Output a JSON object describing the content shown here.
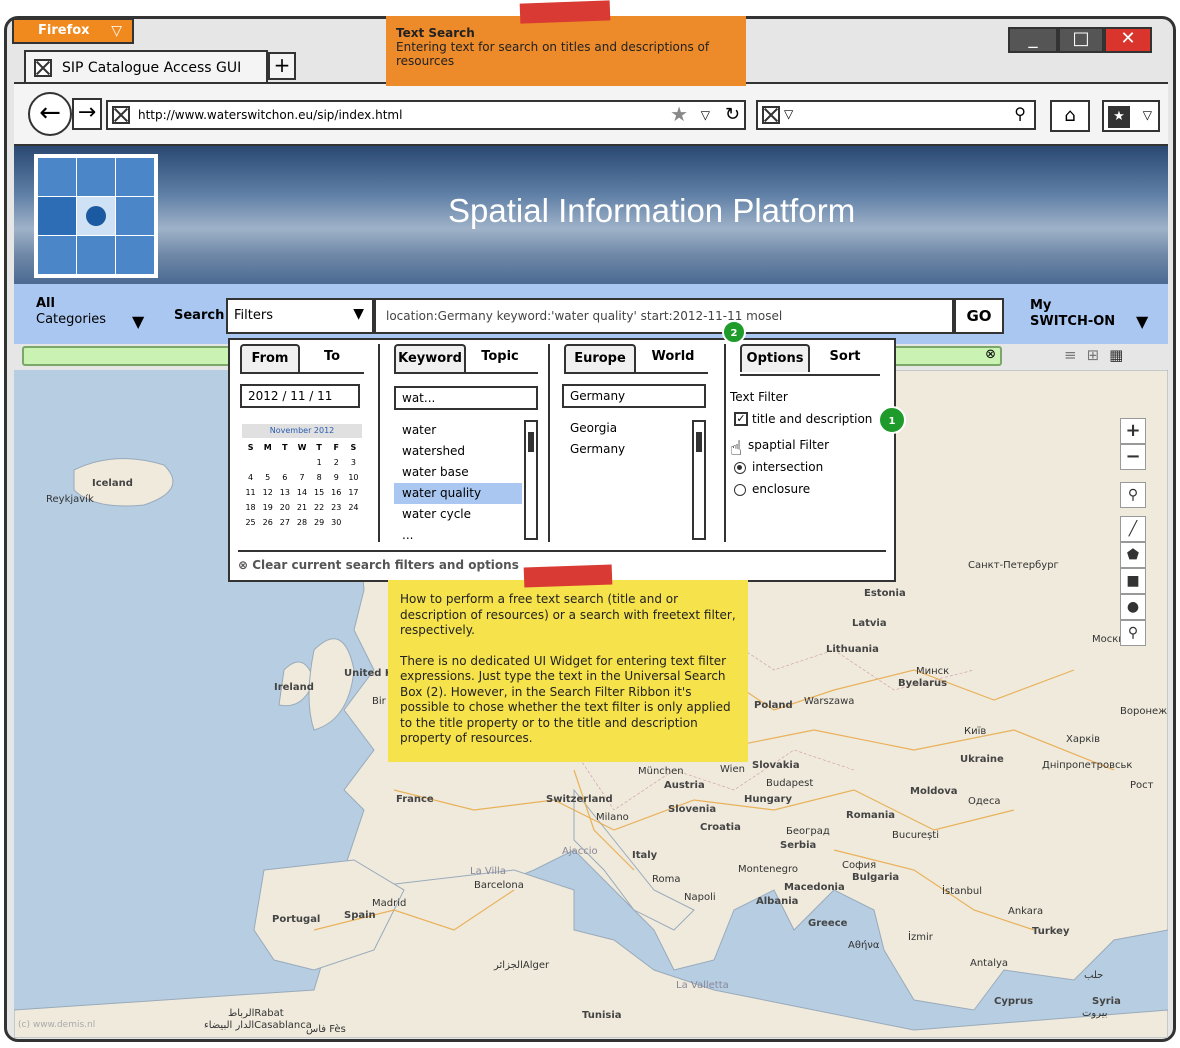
{
  "browser": {
    "menu_button": "Firefox",
    "tab_title": "SIP Catalogue Access GUI",
    "url": "http://www.waterswitchon.eu/sip/index.html"
  },
  "notes": {
    "top_title": "Text Search",
    "top_body": "Entering text for search on titles and descriptions of resources",
    "help_p1": "How to perform a free text search (title and or description of resources) or a search with freetext filter, respectively.",
    "help_p2": "There is no dedicated UI Widget for entering text filter expressions. Just type the text in the Universal Search Box (2). However, in the Search Filter Ribbon it's possible to chose whether the text filter is only applied to the title property or to the title and description property of resources."
  },
  "header": {
    "title": "Spatial Information Platform"
  },
  "toolbar": {
    "categories_line1": "All",
    "categories_line2": "Categories",
    "search_label": "Search",
    "filters_label": "Filters",
    "search_value": "location:Germany keyword:'water quality' start:2012-11-11 mosel",
    "go_label": "GO",
    "my_line1": "My",
    "my_line2": "SWITCH-ON"
  },
  "badges": {
    "b1": "1",
    "b2": "2"
  },
  "ribbon": {
    "time": {
      "tab_from": "From",
      "tab_to": "To",
      "date_value": "2012 / 11 / 11",
      "cal_month": "November 2012",
      "weekdays": [
        "S",
        "M",
        "T",
        "W",
        "T",
        "F",
        "S"
      ],
      "weeks": [
        [
          "",
          "",
          "",
          "",
          "1",
          "2",
          "3"
        ],
        [
          "4",
          "5",
          "6",
          "7",
          "8",
          "9",
          "10"
        ],
        [
          "11",
          "12",
          "13",
          "14",
          "15",
          "16",
          "17"
        ],
        [
          "18",
          "19",
          "20",
          "21",
          "22",
          "23",
          "24"
        ],
        [
          "25",
          "26",
          "27",
          "28",
          "29",
          "30",
          ""
        ]
      ]
    },
    "keyword": {
      "tab_keyword": "Keyword",
      "tab_topic": "Topic",
      "input_value": "wat...",
      "items": [
        "water",
        "watershed",
        "water base",
        "water quality",
        "water cycle",
        "..."
      ]
    },
    "location": {
      "tab_europe": "Europe",
      "tab_world": "World",
      "input_value": "Germany",
      "items": [
        "Georgia",
        "Germany"
      ]
    },
    "options": {
      "tab_options": "Options",
      "tab_sort": "Sort",
      "text_filter_label": "Text Filter",
      "title_desc_label": "title and description",
      "spatial_filter_label": "spaptial Filter",
      "intersection_label": "intersection",
      "enclosure_label": "enclosure"
    },
    "clear_label": "Clear current search filters and options"
  },
  "map_labels": {
    "iceland": "Iceland",
    "reykjavik": "Reykjavík",
    "ireland": "Ireland",
    "united_k": "United K",
    "bir": "Bir",
    "france": "France",
    "switzerland": "Switzerland",
    "portugal": "Portugal",
    "spain": "Spain",
    "madrid": "Madrid",
    "barcelona": "Barcelona",
    "milano": "Milano",
    "italy": "Italy",
    "roma": "Roma",
    "napoli": "Napoli",
    "slovenia": "Slovenia",
    "croatia": "Croatia",
    "austria": "Austria",
    "munchen": "München",
    "wien": "Wien",
    "slovakia": "Slovakia",
    "budapest": "Budapest",
    "hungary": "Hungary",
    "serbia": "Serbia",
    "beograd": "Београд",
    "montenegro": "Montenegro",
    "albania": "Albania",
    "greece": "Greece",
    "athina": "Αθήνα",
    "macedonia": "Macedonia",
    "sofia": "София",
    "bulgaria": "Bulgaria",
    "romania": "Romania",
    "bucuresti": "București",
    "moldova": "Moldova",
    "odesa": "Одеса",
    "ukraine": "Ukraine",
    "kyiv": "Київ",
    "kharkiv": "Харків",
    "dnipro": "Дніпропетровськ",
    "poland": "Poland",
    "warszawa": "Warszawa",
    "belarus": "Byelarus",
    "minsk": "Минск",
    "lithuania": "Lithuania",
    "latvia": "Latvia",
    "estonia": "Estonia",
    "spb": "Санкт-Петербург",
    "moskva": "Москв",
    "voronezh": "Воронеж",
    "rostov": "Рост",
    "istanbul": "İstanbul",
    "ankara": "Ankara",
    "izmir": "İzmir",
    "antalya": "Antalya",
    "turkey": "Turkey",
    "cyprus": "Cyprus",
    "syria": "Syria",
    "halab": "حلب",
    "beirut": "بيروت",
    "tunisia": "Tunisia",
    "alger": "الجزائرAlger",
    "rabat": "الرباطRabat",
    "casablanca": "الدار البيضاءCasablanca",
    "fes": "فاس Fès",
    "la_valletta": "La Valletta",
    "ajaccio": "Ajaccio",
    "la_villa": "La Villa"
  },
  "watermark": "(c) www.demis.nl",
  "colors": {
    "accent": "#a9c7f0",
    "note_orange": "#ed8a2a",
    "note_yellow": "#f6e24b",
    "badge_green": "#1e9b2a"
  }
}
